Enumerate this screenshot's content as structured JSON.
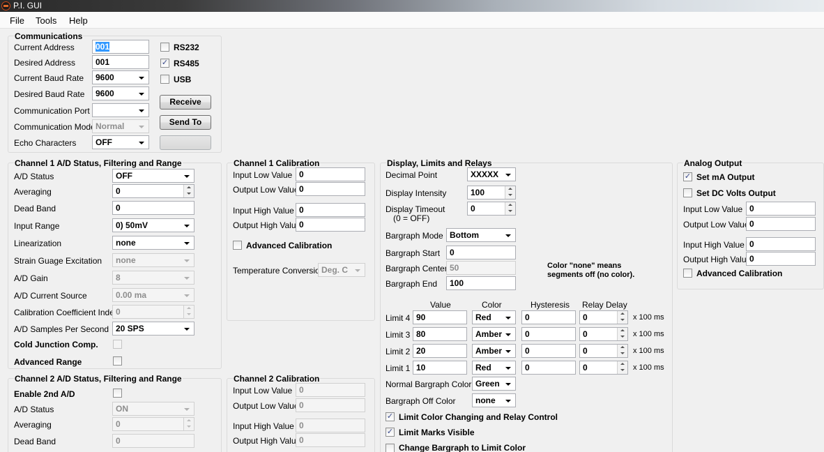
{
  "window": {
    "title": "P.I. GUI"
  },
  "menu": {
    "file": "File",
    "tools": "Tools",
    "help": "Help"
  },
  "comm": {
    "title": "Communications",
    "current_address_label": "Current Address",
    "current_address": "001",
    "desired_address_label": "Desired Address",
    "desired_address": "001",
    "current_baud_label": "Current Baud Rate",
    "current_baud": "9600",
    "desired_baud_label": "Desired Baud Rate",
    "desired_baud": "9600",
    "port_label": "Communication Port",
    "port": "",
    "mode_label": "Communication Mode",
    "mode": "Normal",
    "echo_label": "Echo Characters",
    "echo": "OFF",
    "rs232": "RS232",
    "rs485": "RS485",
    "usb": "USB",
    "rs232_checked": false,
    "rs485_checked": true,
    "usb_checked": false,
    "receive": "Receive",
    "send": "Send To",
    "third_button": ""
  },
  "ch1": {
    "title": "Channel 1 A/D Status, Filtering and Range",
    "status_label": "A/D Status",
    "status": "OFF",
    "averaging_label": "Averaging",
    "averaging": "0",
    "deadband_label": "Dead Band",
    "deadband": "0",
    "range_label": "Input Range",
    "range": "0) 50mV",
    "lin_label": "Linearization",
    "lin": "none",
    "strain_label": "Strain Guage Excitation",
    "strain": "none",
    "gain_label": "A/D Gain",
    "gain": "8",
    "current_label": "A/D Current Source",
    "current": "0.00 ma",
    "calidx_label": "Calibration Coefficient Index",
    "calidx": "0",
    "sps_label": "A/D Samples Per Second",
    "sps": "20 SPS",
    "cjc_label": "Cold Junction Comp.",
    "advrange_label": "Advanced Range"
  },
  "cal1": {
    "title": "Channel 1 Calibration",
    "in_low_label": "Input Low Value",
    "in_low": "0",
    "out_low_label": "Output Low Value",
    "out_low": "0",
    "in_high_label": "Input High Value",
    "in_high": "0",
    "out_high_label": "Output High Value",
    "out_high": "0",
    "adv_label": "Advanced Calibration",
    "temp_label": "Temperature Conversion",
    "temp": "Deg. C"
  },
  "ch2": {
    "title": "Channel 2 A/D Status, Filtering and Range",
    "enable_label": "Enable 2nd A/D",
    "status_label": "A/D Status",
    "status": "ON",
    "averaging_label": "Averaging",
    "averaging": "0",
    "deadband_label": "Dead Band",
    "deadband": "0"
  },
  "cal2": {
    "title": "Channel 2 Calibration",
    "in_low_label": "Input Low Value",
    "in_low": "0",
    "out_low_label": "Output Low Value",
    "out_low": "0",
    "in_high_label": "Input High Value",
    "in_high": "0",
    "out_high_label": "Output High Value",
    "out_high": "0"
  },
  "display": {
    "title": "Display, Limits and Relays",
    "dp_label": "Decimal Point",
    "dp": "XXXXX",
    "intensity_label": "Display Intensity",
    "intensity": "100",
    "timeout_label": "Display Timeout",
    "timeout_sub": "(0 = OFF)",
    "timeout": "0",
    "bg_mode_label": "Bargraph Mode",
    "bg_mode": "Bottom",
    "bg_start_label": "Bargraph Start",
    "bg_start": "0",
    "bg_center_label": "Bargraph Center",
    "bg_center": "50",
    "bg_end_label": "Bargraph End",
    "bg_end": "100",
    "note_line1": "Color \"none\" means",
    "note_line2": "segments off (no color).",
    "col_value": "Value",
    "col_color": "Color",
    "col_hyst": "Hysteresis",
    "col_delay": "Relay Delay",
    "limits": [
      {
        "label": "Limit 4",
        "value": "90",
        "color": "Red",
        "hyst": "0",
        "delay": "0",
        "unit": "x 100 ms"
      },
      {
        "label": "Limit 3",
        "value": "80",
        "color": "Amber",
        "hyst": "0",
        "delay": "0",
        "unit": "x 100 ms"
      },
      {
        "label": "Limit 2",
        "value": "20",
        "color": "Amber",
        "hyst": "0",
        "delay": "0",
        "unit": "x 100 ms"
      },
      {
        "label": "Limit 1",
        "value": "10",
        "color": "Red",
        "hyst": "0",
        "delay": "0",
        "unit": "x 100 ms"
      }
    ],
    "normal_color_label": "Normal Bargraph Color",
    "normal_color": "Green",
    "off_color_label": "Bargraph Off Color",
    "off_color": "none",
    "limit_color_label": "Limit Color Changing and Relay Control",
    "marks_label": "Limit Marks Visible",
    "change_label": "Change Bargraph to Limit Color"
  },
  "analog": {
    "title": "Analog Output",
    "ma_label": "Set mA Output",
    "volts_label": "Set DC Volts Output",
    "in_low_label": "Input Low Value",
    "in_low": "0",
    "out_low_label": "Output Low Value",
    "out_low": "0",
    "in_high_label": "Input High Value",
    "in_high": "0",
    "out_high_label": "Output High Value",
    "out_high": "0",
    "adv_label": "Advanced Calibration"
  }
}
